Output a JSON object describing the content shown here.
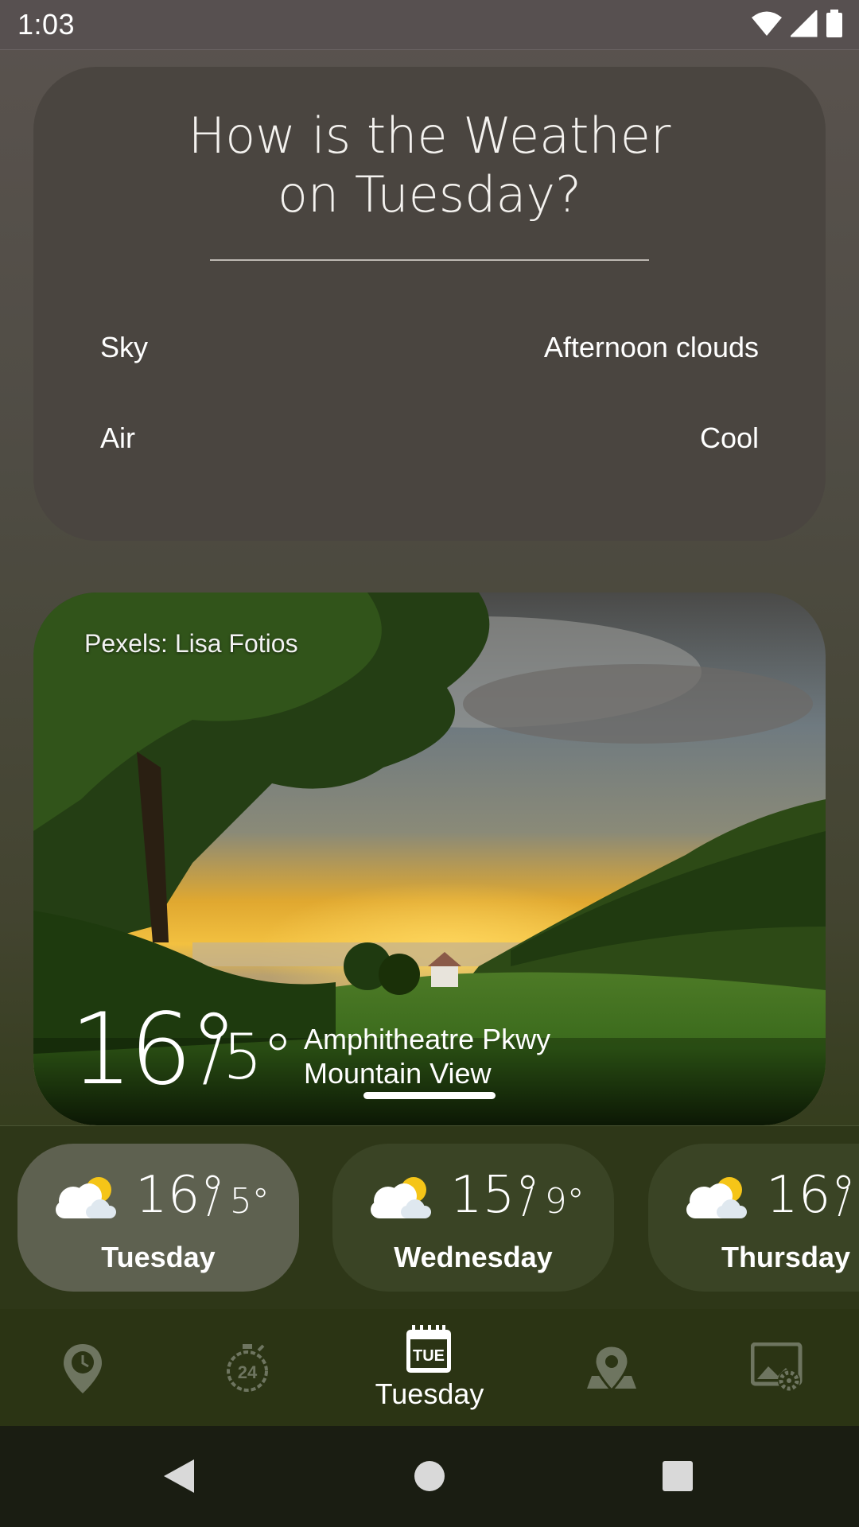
{
  "status_bar": {
    "time": "1:03"
  },
  "info_card": {
    "title_line1": "How is the Weather",
    "title_line2": "on Tuesday?",
    "rows": [
      {
        "label": "Sky",
        "value": "Afternoon clouds"
      },
      {
        "label": "Air",
        "value": "Cool"
      }
    ]
  },
  "photo_card": {
    "credit": "Pexels: Lisa Fotios",
    "temp_high": "16°",
    "temp_low": "/5°",
    "location_line1": "Amphitheatre Pkwy",
    "location_line2": "Mountain View"
  },
  "forecast": [
    {
      "high": "16°",
      "low": "/ 5°",
      "day": "Tuesday",
      "icon": "partly-cloudy-icon",
      "selected": true
    },
    {
      "high": "15°",
      "low": "/ 9°",
      "day": "Wednesday",
      "icon": "partly-cloudy-icon",
      "selected": false
    },
    {
      "high": "16°",
      "low": "/",
      "day": "Thursday",
      "icon": "partly-cloudy-icon",
      "selected": false
    }
  ],
  "bottom_nav": {
    "items": [
      {
        "icon": "location-clock-icon"
      },
      {
        "icon": "24-hour-icon"
      },
      {
        "icon": "calendar-tue-icon",
        "label": "Tuesday",
        "badge": "TUE",
        "selected": true
      },
      {
        "icon": "map-pin-icon"
      },
      {
        "icon": "image-settings-icon"
      }
    ]
  },
  "colors": {
    "accent_sun": "#f5c518",
    "nav_background": "#2b3414",
    "forecast_active": "#5e6150"
  }
}
